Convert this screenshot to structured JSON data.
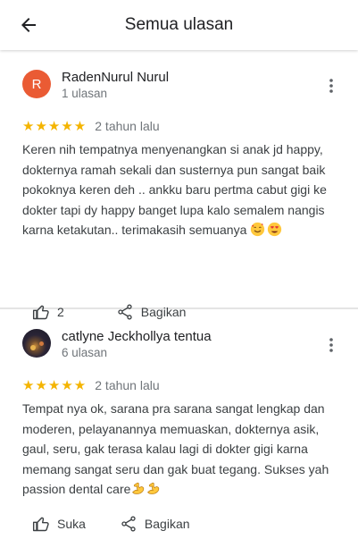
{
  "header": {
    "title": "Semua ulasan",
    "back_icon": "arrow-back-icon"
  },
  "colors": {
    "star": "#f4b400",
    "avatar_r": "#ea5b34",
    "divider": "#e4e4e4",
    "secondary_text": "#70757a"
  },
  "reviews": [
    {
      "avatar_letter": "R",
      "name": "RadenNurul Nurul",
      "sub": "1 ulasan",
      "stars": "★★★★★",
      "rating": 5,
      "date": "2 tahun lalu",
      "text": "Keren nih tempatnya menyenangkan si anak jd happy, dokternya ramah sekali dan susternya pun sangat baik pokoknya keren deh .. ankku baru pertma cabut gigi ke dokter tapi dy happy banget lupa kalo semalem nangis karna ketakutan.. terimakasih semuanya",
      "emojis": [
        "smiling-face-with-hearts-icon",
        "heart-eyes-icon"
      ],
      "like_label": "2",
      "share_label": "Bagikan"
    },
    {
      "avatar_letter": "",
      "name": "catlyne Jeckhollya tentua",
      "sub": "6 ulasan",
      "stars": "★★★★★",
      "rating": 5,
      "date": "2 tahun lalu",
      "text": "Tempat nya ok, sarana pra sarana sangat lengkap dan moderen, pelayanannya memuaskan, dokternya asik, gaul, seru, gak terasa kalau lagi di dokter gigi karna memang sangat seru dan gak buat tegang. Sukses yah passion dental care",
      "emojis": [
        "flexed-biceps-icon",
        "flexed-biceps-icon"
      ],
      "like_label": "Suka",
      "share_label": "Bagikan"
    }
  ]
}
